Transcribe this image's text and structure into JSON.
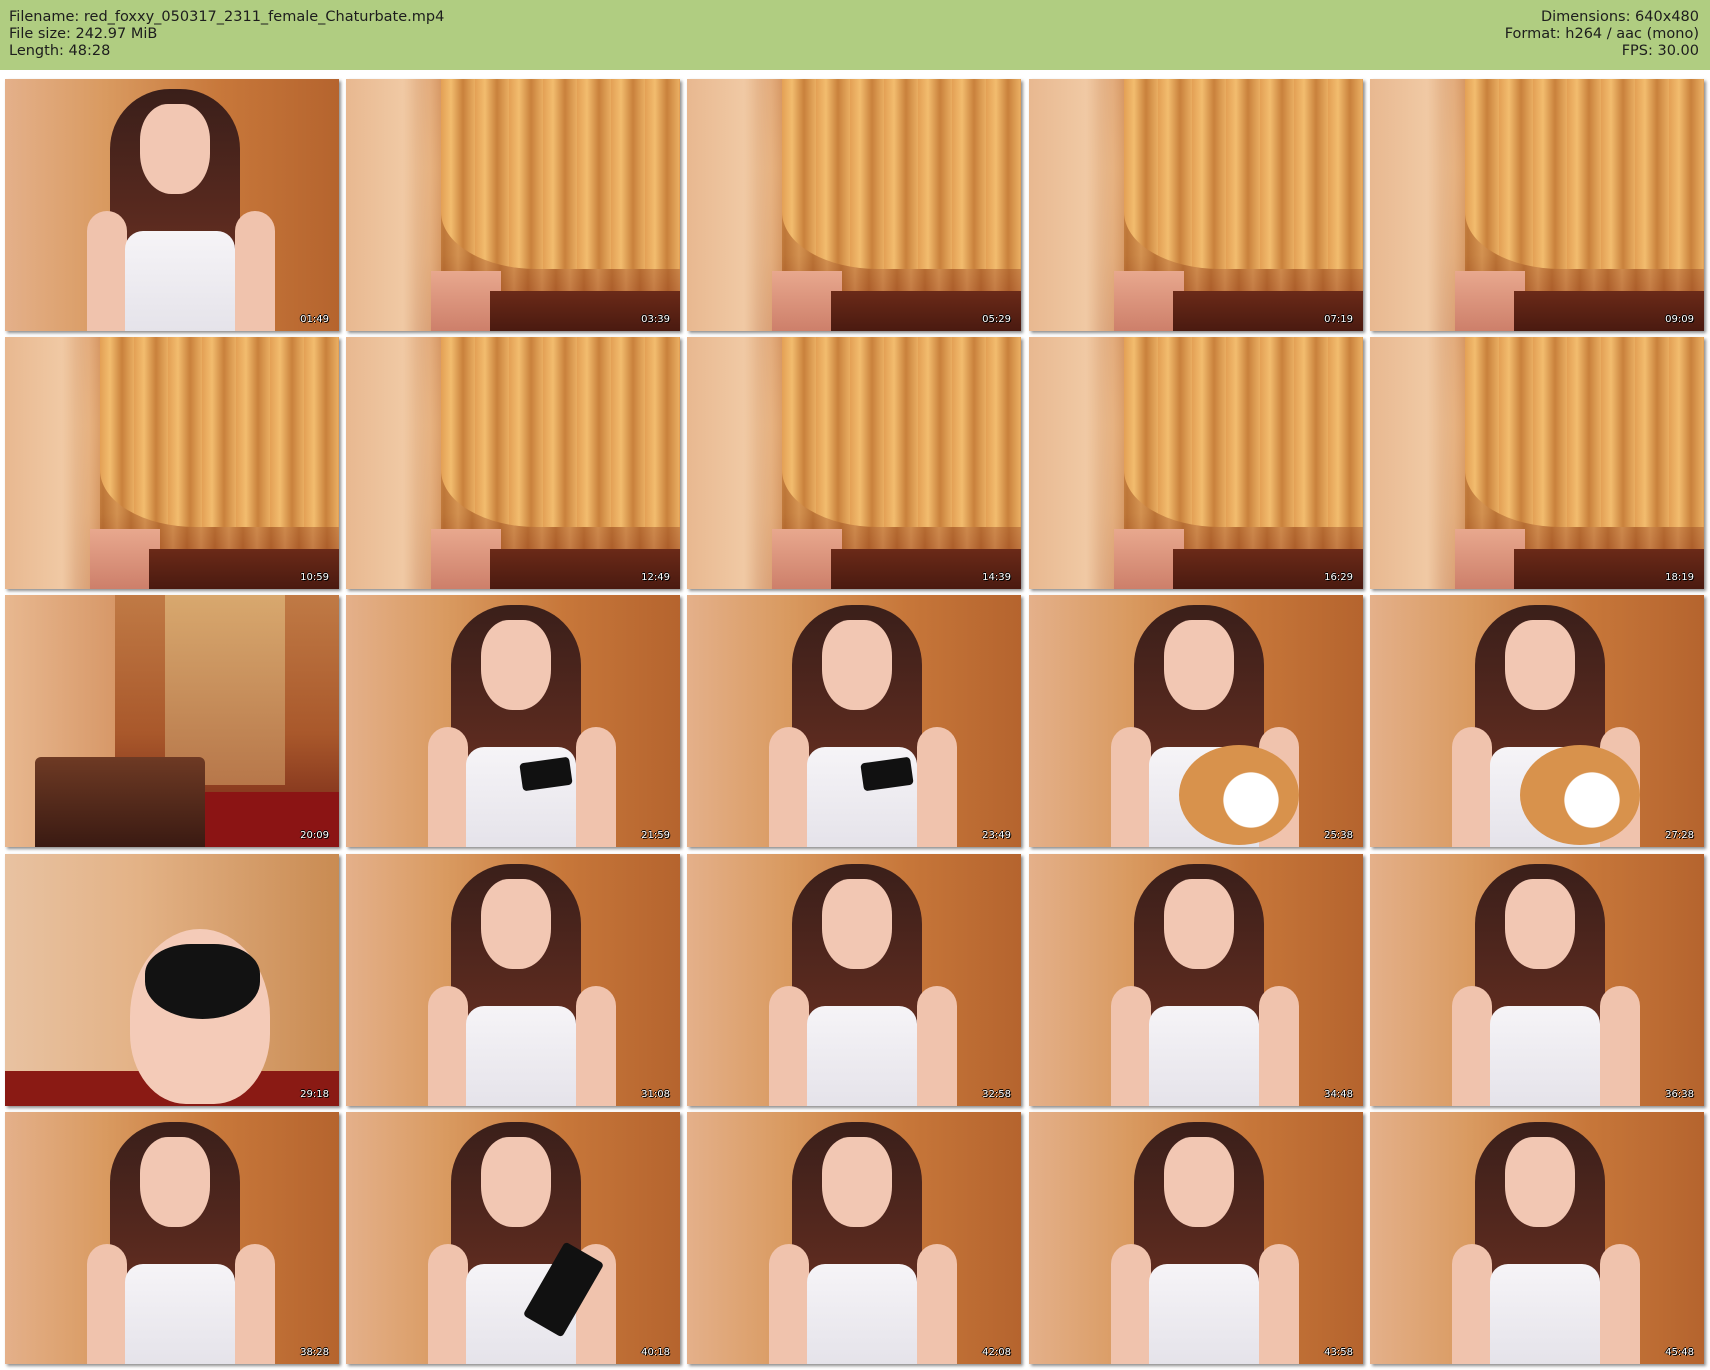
{
  "header": {
    "filename": "Filename: red_foxxy_050317_2311_female_Chaturbate.mp4",
    "filesize": "File size: 242.97 MiB",
    "length": "Length: 48:28",
    "dimensions": "Dimensions: 640x480",
    "format": "Format: h264 / aac (mono)",
    "fps": "FPS: 30.00"
  },
  "colors": {
    "header_bg": "#b0cd81",
    "page_bg": "#ffffff"
  },
  "thumbnails": [
    {
      "timestamp": "01:49",
      "scene": "person-sitting"
    },
    {
      "timestamp": "03:39",
      "scene": "curtain"
    },
    {
      "timestamp": "05:29",
      "scene": "curtain"
    },
    {
      "timestamp": "07:19",
      "scene": "curtain"
    },
    {
      "timestamp": "09:09",
      "scene": "curtain"
    },
    {
      "timestamp": "10:59",
      "scene": "curtain"
    },
    {
      "timestamp": "12:49",
      "scene": "curtain"
    },
    {
      "timestamp": "14:39",
      "scene": "curtain"
    },
    {
      "timestamp": "16:29",
      "scene": "curtain"
    },
    {
      "timestamp": "18:19",
      "scene": "curtain"
    },
    {
      "timestamp": "20:09",
      "scene": "room"
    },
    {
      "timestamp": "21:59",
      "scene": "person-phone"
    },
    {
      "timestamp": "23:49",
      "scene": "person-phone"
    },
    {
      "timestamp": "25:38",
      "scene": "person-plush"
    },
    {
      "timestamp": "27:28",
      "scene": "person-plush"
    },
    {
      "timestamp": "29:18",
      "scene": "bending"
    },
    {
      "timestamp": "31:08",
      "scene": "person"
    },
    {
      "timestamp": "32:58",
      "scene": "person"
    },
    {
      "timestamp": "34:48",
      "scene": "person"
    },
    {
      "timestamp": "36:38",
      "scene": "person"
    },
    {
      "timestamp": "38:28",
      "scene": "person"
    },
    {
      "timestamp": "40:18",
      "scene": "person-phone-big"
    },
    {
      "timestamp": "42:08",
      "scene": "person"
    },
    {
      "timestamp": "43:58",
      "scene": "person"
    },
    {
      "timestamp": "45:48",
      "scene": "person"
    }
  ]
}
